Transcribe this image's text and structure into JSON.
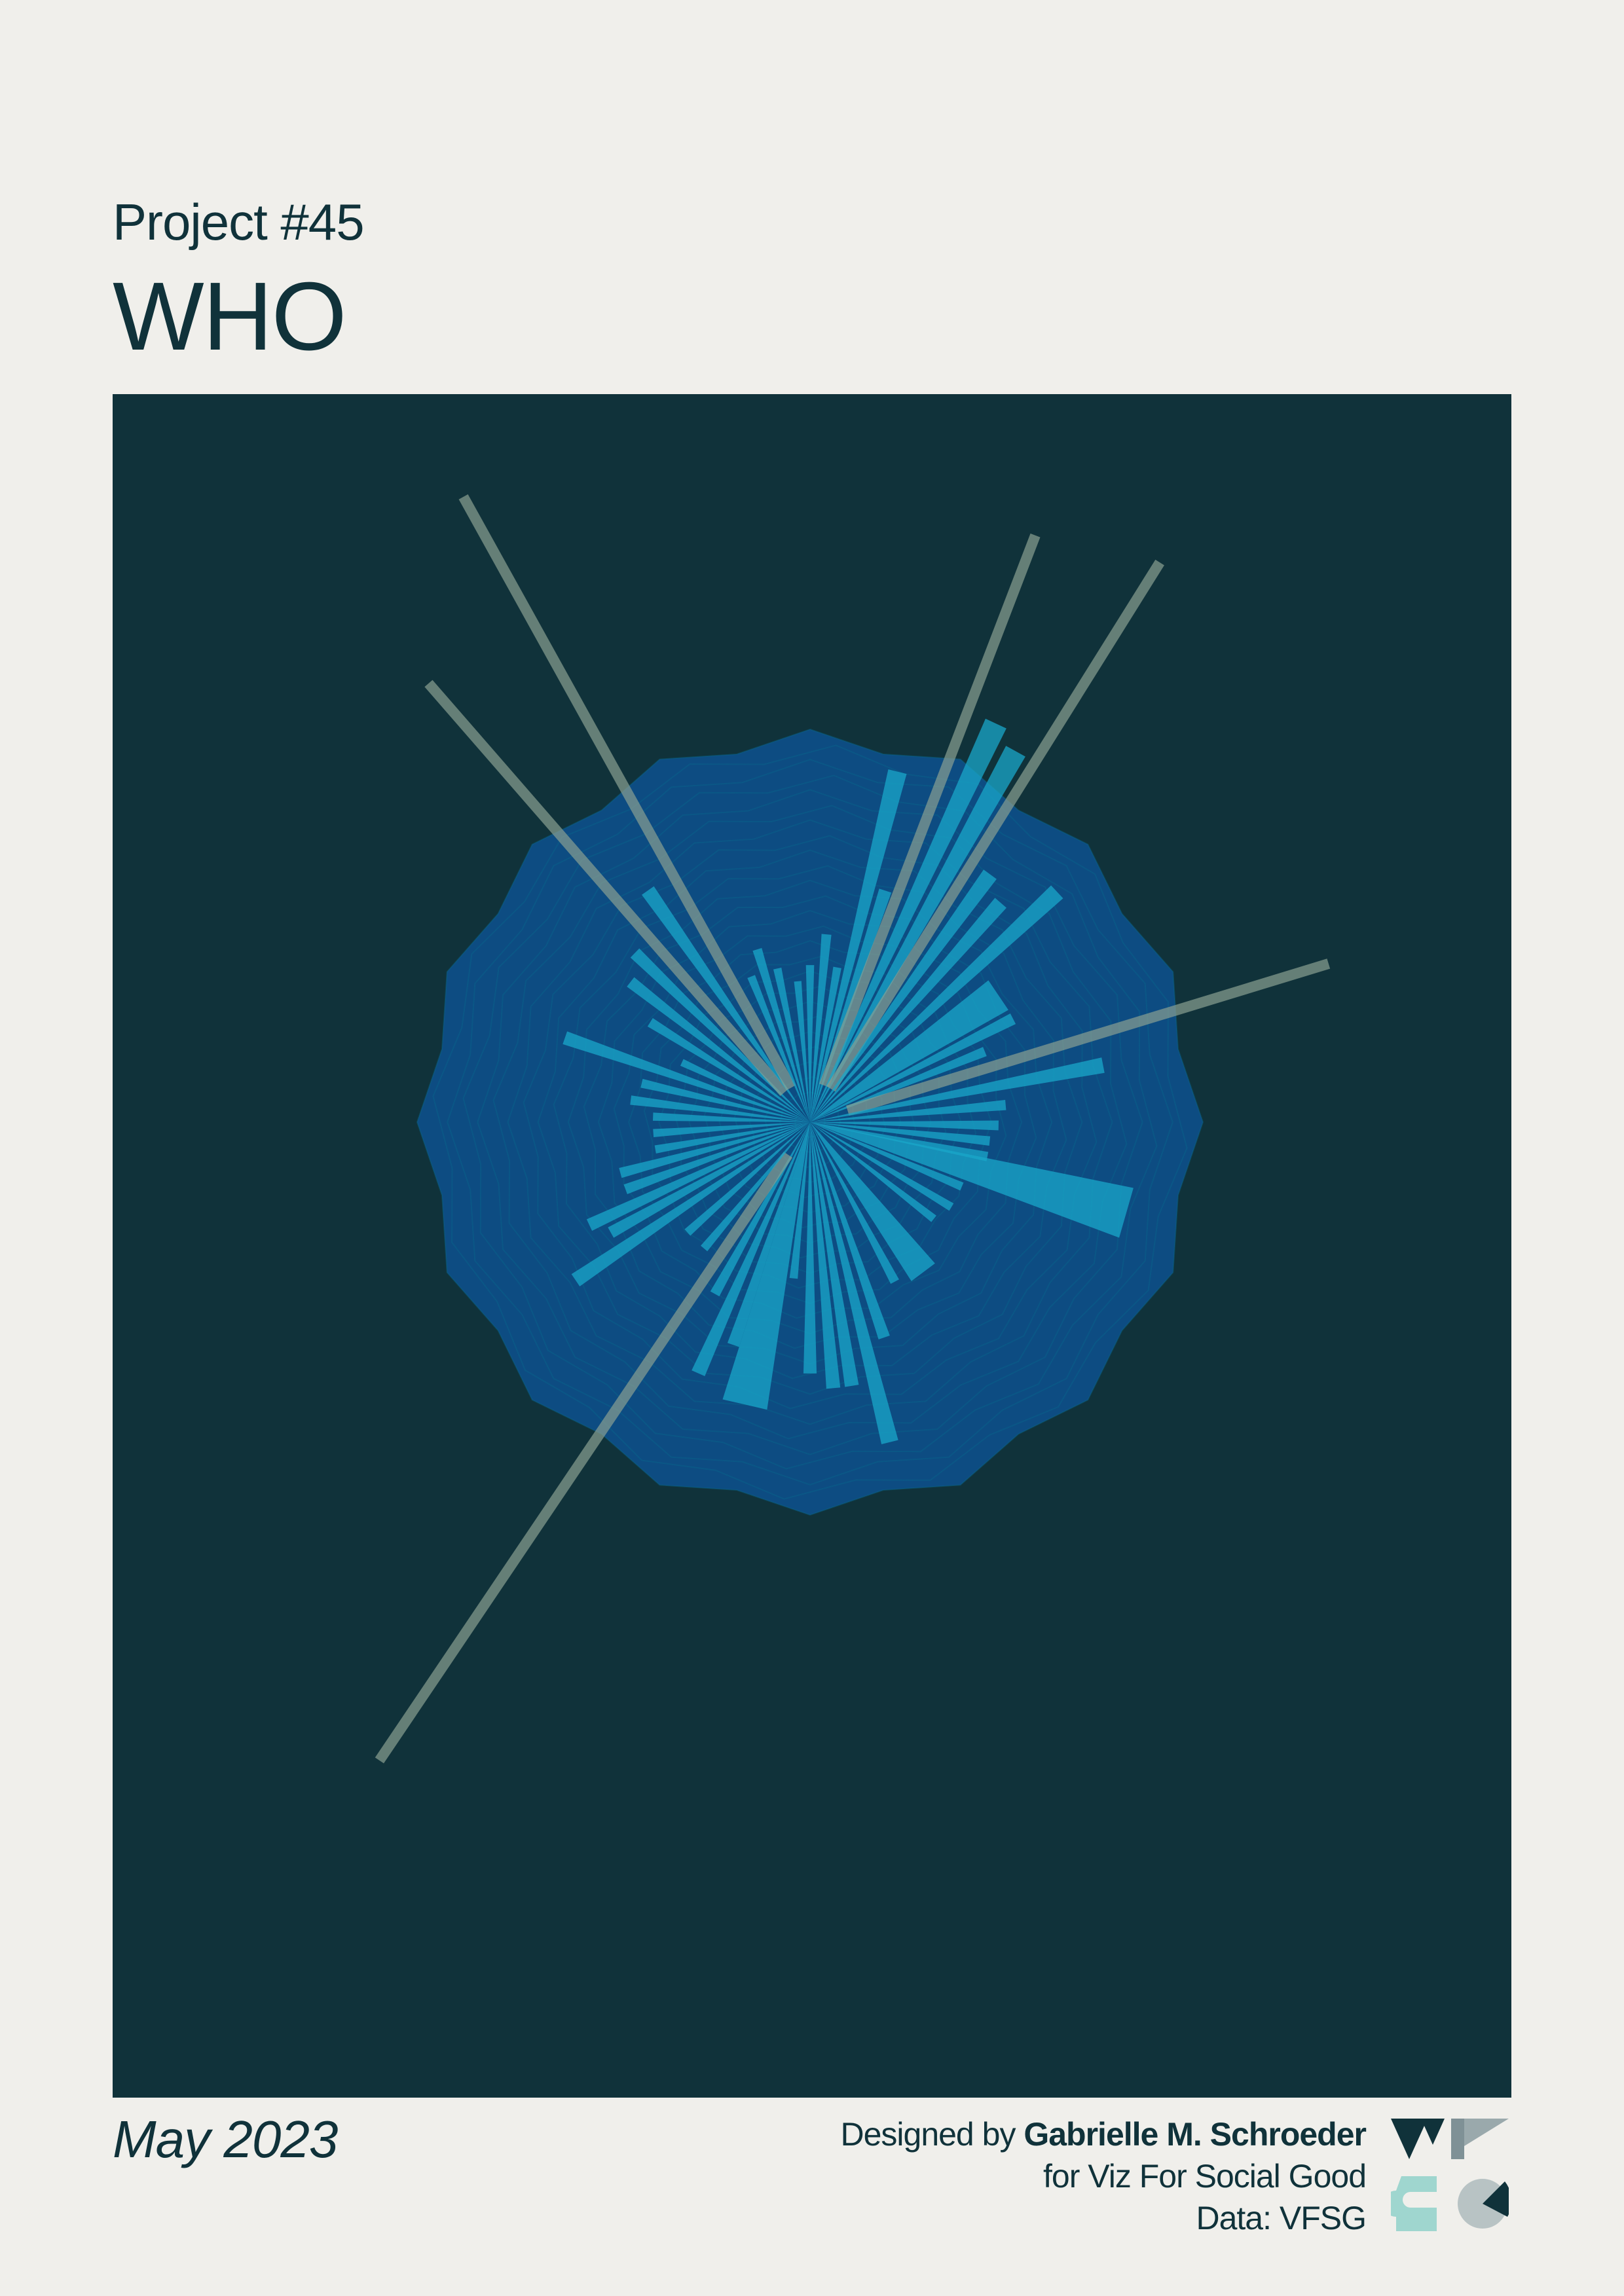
{
  "header": {
    "subtitle": "Project #45",
    "title": "WHO"
  },
  "footer": {
    "date": "May 2023",
    "designed_by_prefix": "Designed by",
    "designer": "Gabrielle M. Schroeder",
    "for_line": "for Viz For Social Good",
    "data_line": "Data: VFSG"
  },
  "logo": {
    "icon": "vfsg-logo-icon"
  },
  "colors": {
    "background": "#f0efeb",
    "panel": "#10323a",
    "text": "#10323a",
    "polygon": "#0e4e86",
    "bar": "#1aa7c9",
    "long_bar": "#8a9f91"
  },
  "chart_data": {
    "type": "radial-bar",
    "title": "",
    "xlabel": "",
    "ylabel": "",
    "grid": false,
    "legend": "none",
    "polygon_sides": 16,
    "bars": [
      {
        "angle": 0.0,
        "value": 0.4,
        "width": 3.0
      },
      {
        "angle": 5.0,
        "value": 0.48,
        "width": 3.0
      },
      {
        "angle": 10.0,
        "value": 0.4,
        "width": 3.0
      },
      {
        "angle": 14.0,
        "value": 0.92,
        "width": 3.0
      },
      {
        "angle": 18.0,
        "value": 0.62,
        "width": 3.0
      },
      {
        "angle": 21.0,
        "value": 1.6,
        "width": 2.2,
        "long": true
      },
      {
        "angle": 25.0,
        "value": 1.12,
        "width": 3.0
      },
      {
        "angle": 29.0,
        "value": 1.08,
        "width": 3.0
      },
      {
        "angle": 32.0,
        "value": 1.68,
        "width": 2.5,
        "long": true
      },
      {
        "angle": 36.0,
        "value": 0.78,
        "width": 3.0
      },
      {
        "angle": 41.0,
        "value": 0.74,
        "width": 3.0
      },
      {
        "angle": 47.0,
        "value": 0.86,
        "width": 3.0
      },
      {
        "angle": 56.0,
        "value": 0.58,
        "width": 9.0
      },
      {
        "angle": 63.0,
        "value": 0.58,
        "width": 3.0
      },
      {
        "angle": 68.0,
        "value": 0.48,
        "width": 3.0
      },
      {
        "angle": 73.0,
        "value": 1.38,
        "width": 2.4,
        "long": true
      },
      {
        "angle": 79.0,
        "value": 0.76,
        "width": 3.0
      },
      {
        "angle": 85.0,
        "value": 0.5,
        "width": 3.0
      },
      {
        "angle": 91.0,
        "value": 0.48,
        "width": 3.0
      },
      {
        "angle": 96.0,
        "value": 0.46,
        "width": 3.0
      },
      {
        "angle": 101.0,
        "value": 0.46,
        "width": 3.0
      },
      {
        "angle": 106.0,
        "value": 0.84,
        "width": 9.0
      },
      {
        "angle": 113.0,
        "value": 0.42,
        "width": 3.0
      },
      {
        "angle": 121.0,
        "value": 0.42,
        "width": 3.0
      },
      {
        "angle": 128.0,
        "value": 0.4,
        "width": 3.0
      },
      {
        "angle": 143.0,
        "value": 0.48,
        "width": 9.0
      },
      {
        "angle": 152.0,
        "value": 0.46,
        "width": 3.0
      },
      {
        "angle": 161.0,
        "value": 0.58,
        "width": 3.0
      },
      {
        "angle": 166.0,
        "value": 0.84,
        "width": 3.0
      },
      {
        "angle": 171.0,
        "value": 0.68,
        "width": 3.0
      },
      {
        "angle": 175.0,
        "value": 0.68,
        "width": 3.0
      },
      {
        "angle": 180.0,
        "value": 0.64,
        "width": 3.0
      },
      {
        "angle": 186.0,
        "value": 0.4,
        "width": 3.0
      },
      {
        "angle": 193.0,
        "value": 0.74,
        "width": 9.0
      },
      {
        "angle": 199.0,
        "value": 0.6,
        "width": 3.0
      },
      {
        "angle": 204.0,
        "value": 0.7,
        "width": 3.0
      },
      {
        "angle": 209.0,
        "value": 0.5,
        "width": 3.0
      },
      {
        "angle": 214.0,
        "value": 1.96,
        "width": 2.2,
        "long": true
      },
      {
        "angle": 220.0,
        "value": 0.42,
        "width": 3.0
      },
      {
        "angle": 228.0,
        "value": 0.42,
        "width": 3.0
      },
      {
        "angle": 236.0,
        "value": 0.72,
        "width": 3.0
      },
      {
        "angle": 241.0,
        "value": 0.58,
        "width": 3.0
      },
      {
        "angle": 245.0,
        "value": 0.62,
        "width": 3.0
      },
      {
        "angle": 250.0,
        "value": 0.5,
        "width": 3.0
      },
      {
        "angle": 255.0,
        "value": 0.5,
        "width": 3.0
      },
      {
        "angle": 260.0,
        "value": 0.4,
        "width": 3.0
      },
      {
        "angle": 266.0,
        "value": 0.4,
        "width": 3.0
      },
      {
        "angle": 272.0,
        "value": 0.4,
        "width": 3.0
      },
      {
        "angle": 277.0,
        "value": 0.46,
        "width": 3.0
      },
      {
        "angle": 283.0,
        "value": 0.44,
        "width": 3.0
      },
      {
        "angle": 289.0,
        "value": 0.66,
        "width": 3.0
      },
      {
        "angle": 295.0,
        "value": 0.36,
        "width": 3.0
      },
      {
        "angle": 302.0,
        "value": 0.48,
        "width": 3.0
      },
      {
        "angle": 308.0,
        "value": 0.58,
        "width": 3.0
      },
      {
        "angle": 314.0,
        "value": 0.62,
        "width": 3.0
      },
      {
        "angle": 319.0,
        "value": 1.48,
        "width": 2.0,
        "long": true
      },
      {
        "angle": 325.0,
        "value": 0.72,
        "width": 3.0
      },
      {
        "angle": 331.0,
        "value": 1.82,
        "width": 2.2,
        "long": true
      },
      {
        "angle": 338.0,
        "value": 0.4,
        "width": 3.0
      },
      {
        "angle": 343.0,
        "value": 0.46,
        "width": 3.0
      },
      {
        "angle": 348.0,
        "value": 0.4,
        "width": 3.0
      },
      {
        "angle": 355.0,
        "value": 0.36,
        "width": 3.0
      }
    ]
  }
}
